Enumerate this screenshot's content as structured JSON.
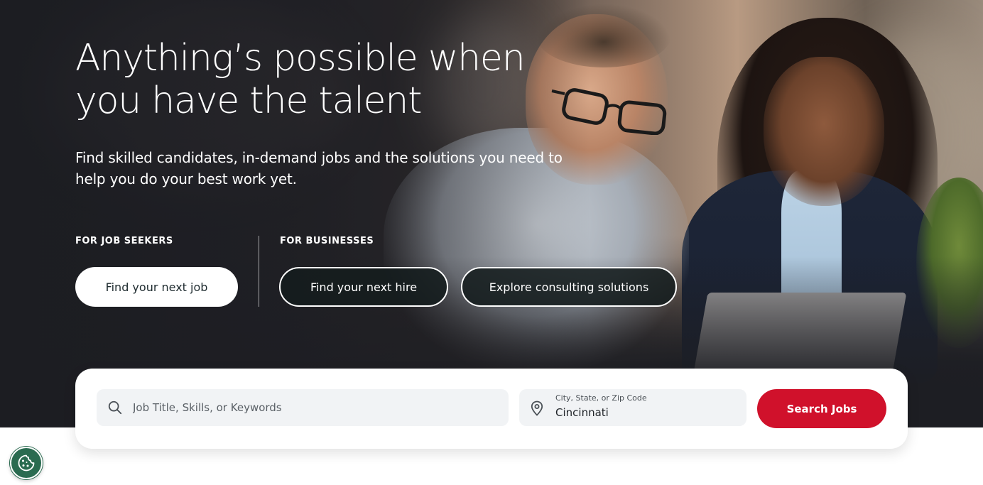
{
  "hero": {
    "headline": "Anything’s possible when you have the talent",
    "subheadline": "Find skilled candidates, in-demand jobs and the solutions you need to help you do your best work yet."
  },
  "job_seekers": {
    "label": "FOR JOB SEEKERS",
    "find_job_label": "Find your next job"
  },
  "businesses": {
    "label": "FOR BUSINESSES",
    "find_hire_label": "Find your next hire",
    "consulting_label": "Explore consulting solutions"
  },
  "search": {
    "keywords_placeholder": "Job Title, Skills, or Keywords",
    "location_label": "City, State, or Zip Code",
    "location_value": "Cincinnati",
    "submit_label": "Search Jobs"
  },
  "icons": {
    "search": "search-icon",
    "location": "location-pin-icon",
    "cookie": "cookie-icon"
  },
  "colors": {
    "accent_red": "#d0112b",
    "cookie_green": "#2a6b50",
    "hero_dark": "#1d1e23"
  }
}
